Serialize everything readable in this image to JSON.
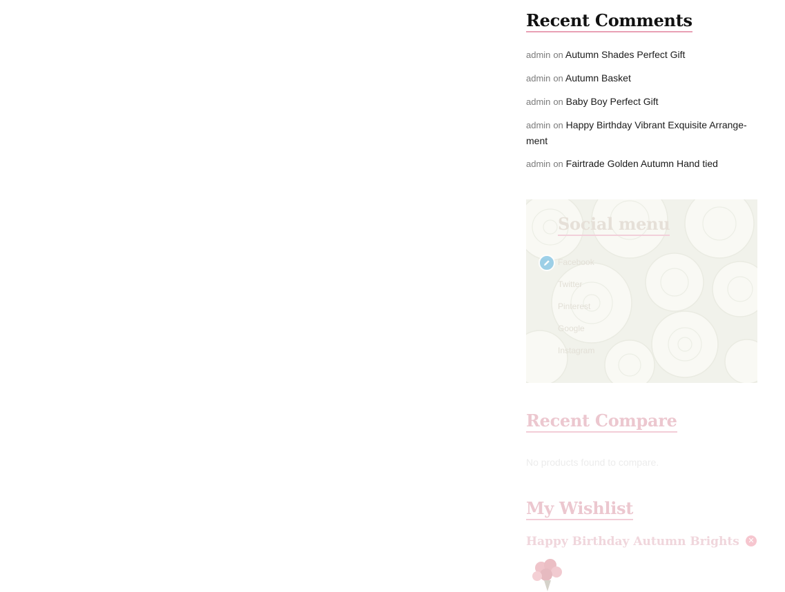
{
  "recent_comments": {
    "title": "Recent Comments",
    "on_word": "on",
    "items": [
      {
        "author": "admin",
        "post": "Autumn Shades Perfect Gift"
      },
      {
        "author": "admin",
        "post": "Autumn Basket"
      },
      {
        "author": "admin",
        "post": "Baby Boy Perfect Gift"
      },
      {
        "author": "admin",
        "post": "Happy Birthday Vibrant Exquisite Arrange-ment"
      },
      {
        "author": "admin",
        "post": "Fairtrade Golden Autumn Hand tied"
      }
    ]
  },
  "social_menu": {
    "title": "Social menu",
    "items": [
      "Facebook",
      "Twitter",
      "Pinterest",
      "Google",
      "Instagram"
    ],
    "edit_icon": "pencil-icon"
  },
  "recent_compare": {
    "title": "Recent Compare",
    "empty_text": "No products found to compare."
  },
  "wishlist": {
    "title": "My Wishlist",
    "item_title": "Happy Birthday Autumn Brights",
    "remove_icon": "close-icon",
    "thumb_icon": "flower-bouquet-image"
  },
  "colors": {
    "title_underline": "#e8a0b4",
    "text_dark": "#1a1a1a",
    "text_muted": "#7a7a7a",
    "edit_badge": "#8ec9e6"
  }
}
